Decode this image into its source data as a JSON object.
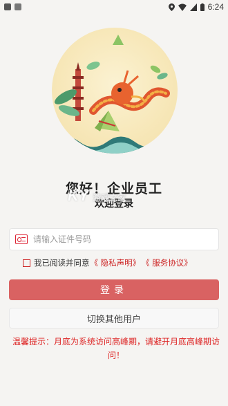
{
  "status_bar": {
    "time": "6:24"
  },
  "header": {
    "greeting": "您好！企业员工",
    "welcome": "欢迎登录",
    "watermark": "KY",
    "watermark_sub": "游戏之家"
  },
  "form": {
    "id_placeholder": "请输入证件号码",
    "agree_prefix": "我已阅读并同意",
    "privacy_link": "《 隐私声明》",
    "service_link": "《 服务协议》",
    "login_label": "登录",
    "switch_user_label": "切换其他用户"
  },
  "notice": {
    "text": "温馨提示：月底为系统访问高峰期，请避开月底高峰期访问！"
  },
  "colors": {
    "accent": "#d96262",
    "warning": "#dd2222"
  }
}
